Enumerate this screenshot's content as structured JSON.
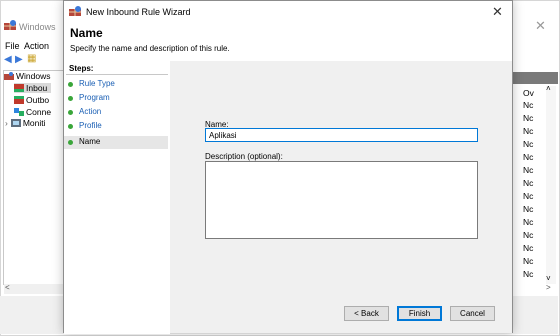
{
  "background_window": {
    "title": "Windows",
    "menu": [
      "File",
      "Action"
    ],
    "tree": {
      "root": "Windows",
      "items": [
        "Inbou",
        "Outbo",
        "Conne",
        "Moniti"
      ]
    },
    "right_column": {
      "header": "Ov",
      "cells": [
        "Nc",
        "Nc",
        "Nc",
        "Nc",
        "Nc",
        "Nc",
        "Nc",
        "Nc",
        "Nc",
        "Nc",
        "Nc",
        "Nc",
        "Nc",
        "Nc",
        "Nc",
        "Nc"
      ]
    },
    "colors": {
      "header_bar": "#7a7a7a",
      "selected_tree": "#d9d9d9"
    }
  },
  "wizard": {
    "title": "New Inbound Rule Wizard",
    "heading": "Name",
    "subheading": "Specify the name and description of this rule.",
    "steps_label": "Steps:",
    "steps": [
      {
        "label": "Rule Type",
        "current": false
      },
      {
        "label": "Program",
        "current": false
      },
      {
        "label": "Action",
        "current": false
      },
      {
        "label": "Profile",
        "current": false
      },
      {
        "label": "Name",
        "current": true
      }
    ],
    "name_field": {
      "label": "Name:",
      "value": "Aplikasi"
    },
    "description_field": {
      "label": "Description (optional):",
      "value": ""
    },
    "buttons": {
      "back": "< Back",
      "finish": "Finish",
      "cancel": "Cancel"
    },
    "colors": {
      "step_dot": "#3aa63a",
      "step_link": "#1a5fb4",
      "focus_border": "#0078d7",
      "content_bg": "#f0f0f0"
    }
  }
}
